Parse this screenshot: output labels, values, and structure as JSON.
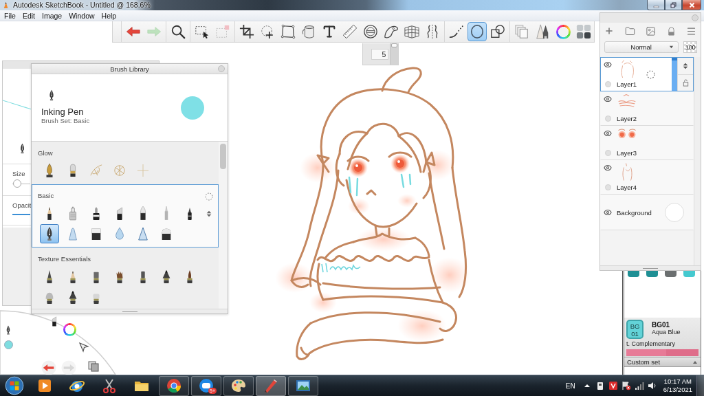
{
  "window": {
    "title": "Autodesk SketchBook - Untitled @ 168.6%"
  },
  "menu": [
    {
      "label": "File"
    },
    {
      "label": "Edit"
    },
    {
      "label": "Image"
    },
    {
      "label": "Window"
    },
    {
      "label": "Help"
    }
  ],
  "toolbar": {
    "groups": [
      {
        "tools": [
          {
            "kind": "undo",
            "selected": false,
            "disabled": false
          },
          {
            "kind": "redo",
            "selected": false,
            "disabled": true
          }
        ]
      },
      {
        "tools": [
          {
            "kind": "zoom",
            "selected": false,
            "disabled": false
          }
        ]
      },
      {
        "tools": [
          {
            "kind": "select",
            "selected": false,
            "disabled": false
          },
          {
            "kind": "selection-clear",
            "selected": false,
            "disabled": true
          }
        ]
      },
      {
        "tools": [
          {
            "kind": "crop",
            "selected": false,
            "disabled": false
          },
          {
            "kind": "transform",
            "selected": false,
            "disabled": false
          },
          {
            "kind": "distort",
            "selected": false,
            "disabled": false
          },
          {
            "kind": "fill",
            "selected": false,
            "disabled": false
          },
          {
            "kind": "text",
            "selected": false,
            "disabled": false
          },
          {
            "kind": "ruler",
            "selected": false,
            "disabled": false
          },
          {
            "kind": "ellipse-guide",
            "selected": false,
            "disabled": false
          },
          {
            "kind": "french-curve",
            "selected": false,
            "disabled": false
          },
          {
            "kind": "perspective",
            "selected": false,
            "disabled": false
          },
          {
            "kind": "symmetry",
            "selected": false,
            "disabled": false
          }
        ]
      },
      {
        "tools": [
          {
            "kind": "stroke",
            "selected": false,
            "disabled": false
          },
          {
            "kind": "ellipse",
            "selected": true,
            "disabled": false
          },
          {
            "kind": "shapes",
            "selected": false,
            "disabled": false
          }
        ]
      },
      {
        "tools": [
          {
            "kind": "copy",
            "selected": false,
            "disabled": false
          },
          {
            "kind": "brushes",
            "selected": false,
            "disabled": false
          },
          {
            "kind": "color-wheel",
            "selected": false,
            "disabled": false
          },
          {
            "kind": "swatches",
            "selected": false,
            "disabled": false
          }
        ]
      }
    ]
  },
  "brush_size": {
    "value": "5",
    "level": 1
  },
  "brush_properties": {
    "size": {
      "label": "Size",
      "level": 0.05
    },
    "opacity": {
      "label": "Opacit",
      "level": 1
    }
  },
  "brush_library": {
    "title": "Brush Library",
    "current": {
      "name": "Inking Pen",
      "set": "Brush Set: Basic"
    },
    "sets": [
      {
        "name": "Glow",
        "selected": false,
        "brushes": [
          {
            "kind": "glow-nib",
            "selected": false
          },
          {
            "kind": "glow-marker",
            "selected": false
          },
          {
            "kind": "glow-leaf",
            "selected": false
          },
          {
            "kind": "glow-ring",
            "selected": false
          },
          {
            "kind": "glow-cross",
            "selected": false
          }
        ]
      },
      {
        "name": "Basic",
        "selected": true,
        "brushes": [
          {
            "kind": "pencil",
            "selected": false
          },
          {
            "kind": "airbrush",
            "selected": false
          },
          {
            "kind": "marker",
            "selected": false
          },
          {
            "kind": "chisel",
            "selected": false
          },
          {
            "kind": "ballpoint",
            "selected": false
          },
          {
            "kind": "fineliner",
            "selected": false
          },
          {
            "kind": "felt-pen",
            "selected": false
          },
          {
            "kind": "nib",
            "selected": true
          },
          {
            "kind": "soft-cone",
            "selected": false
          },
          {
            "kind": "eraser-block",
            "selected": false
          },
          {
            "kind": "drop",
            "selected": false
          },
          {
            "kind": "hard-cone",
            "selected": false
          },
          {
            "kind": "soft-eraser",
            "selected": false
          }
        ]
      },
      {
        "name": "Texture Essentials",
        "selected": false,
        "brushes": [
          {
            "kind": "tex-pointed",
            "selected": false
          },
          {
            "kind": "tex-pencil",
            "selected": false
          },
          {
            "kind": "tex-block",
            "selected": false
          },
          {
            "kind": "tex-bristle",
            "selected": false
          },
          {
            "kind": "tex-stick",
            "selected": false
          },
          {
            "kind": "tex-cone",
            "selected": false
          },
          {
            "kind": "tex-brush",
            "selected": false
          },
          {
            "kind": "tex-dome",
            "selected": false
          },
          {
            "kind": "tex-cone",
            "selected": false
          },
          {
            "kind": "tex-flat",
            "selected": false
          }
        ]
      }
    ]
  },
  "layers": {
    "blend_mode": "Normal",
    "opacity": "100",
    "opacity_slider": {
      "level": 1
    },
    "items": [
      {
        "kind": "layer",
        "name": "Layer1",
        "selected": true,
        "visible": true
      },
      {
        "kind": "layer",
        "name": "Layer2",
        "selected": false,
        "visible": true
      },
      {
        "kind": "layer",
        "name": "Layer3",
        "selected": false,
        "visible": true
      },
      {
        "kind": "layer",
        "name": "Layer4",
        "selected": false,
        "visible": true
      },
      {
        "kind": "background",
        "name": "Background",
        "selected": false,
        "visible": true
      }
    ]
  },
  "color_panel": {
    "swatches": [
      {
        "color": "#1f8f94"
      },
      {
        "color": "#1f8f94"
      },
      {
        "color": "#6b6f70"
      },
      {
        "color": "#45c9cf"
      }
    ],
    "current": {
      "chip": "BG 01",
      "code": "BG01",
      "name": "Aqua Blue"
    },
    "complementary": "t. Complementary",
    "custom_set": "Custom set"
  },
  "taskbar": {
    "apps": [
      {
        "kind": "media-player",
        "running": false,
        "active": false
      },
      {
        "kind": "web-browser",
        "running": false,
        "active": false
      },
      {
        "kind": "scissors",
        "running": false,
        "active": false
      },
      {
        "kind": "folder",
        "running": false,
        "active": false
      },
      {
        "kind": "round-browser",
        "running": true,
        "active": false
      },
      {
        "kind": "chat",
        "running": true,
        "active": false,
        "badge": "5+"
      },
      {
        "kind": "palette",
        "running": true,
        "active": false
      },
      {
        "kind": "pencil",
        "running": true,
        "active": true
      },
      {
        "kind": "photo-viewer",
        "running": true,
        "active": false
      }
    ],
    "tray": {
      "language": "EN",
      "time": "10:17 AM",
      "date": "6/13/2021"
    }
  }
}
